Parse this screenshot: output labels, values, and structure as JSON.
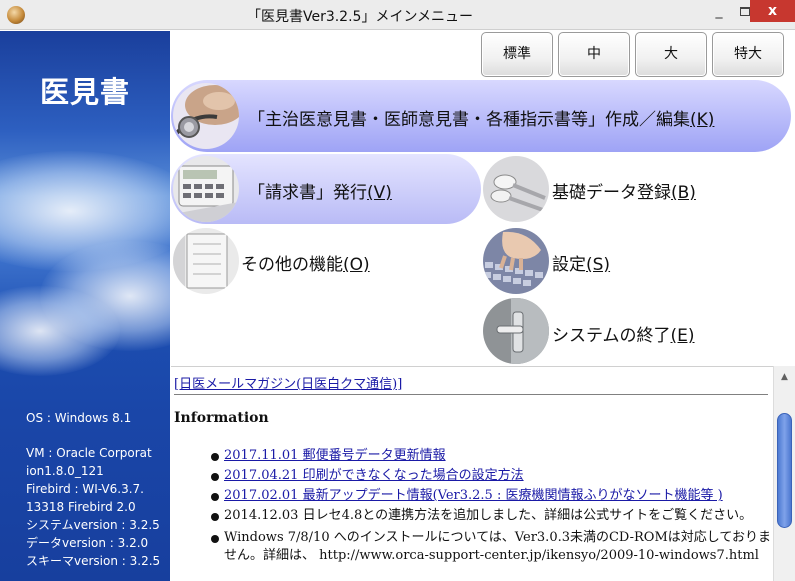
{
  "window": {
    "title": "「医見書Ver3.2.5」メインメニュー",
    "minimize_glyph": "_",
    "close_glyph": "x"
  },
  "sidebar": {
    "logo": "医見書",
    "info_lines": [
      "OS : Windows 8.1",
      "",
      "VM : Oracle Corporat",
      "ion1.8.0_121",
      "Firebird : WI-V6.3.7.",
      "13318 Firebird 2.0",
      "システムversion : 3.2.5",
      "データversion : 3.2.0",
      "スキーマversion : 3.2.5"
    ]
  },
  "size_buttons": [
    "標準",
    "中",
    "大",
    "特大"
  ],
  "menu": {
    "main": {
      "label": "「主治医意見書・医師意見書・各種指示書等」作成／編集",
      "key": "(K)"
    },
    "billing": {
      "label": "「請求書」発行",
      "key": "(V)"
    },
    "basic_data": {
      "label": "基礎データ登録",
      "key": "(B)"
    },
    "other": {
      "label": "その他の機能",
      "key": "(O)"
    },
    "settings": {
      "label": "設定",
      "key": "(S)"
    },
    "exit": {
      "label": "システムの終了",
      "key": "(E)"
    }
  },
  "info_panel": {
    "newsletter_link": "[日医メールマガジン(日医白クマ通信)]",
    "heading": "Information",
    "items": [
      {
        "type": "link",
        "text": "2017.11.01 郵便番号データ更新情報"
      },
      {
        "type": "link",
        "text": "2017.04.21 印刷ができなくなった場合の設定方法"
      },
      {
        "type": "link",
        "text": "2017.02.01 最新アップデート情報(Ver3.2.5 : 医療機関情報ふりがなソート機能等 )"
      },
      {
        "type": "text",
        "text": "2014.12.03 日レセ4.8との連携方法を追加しました、詳細は公式サイトをご覧ください。"
      },
      {
        "type": "text",
        "text": "Windows 7/8/10 へのインストールについては、Ver3.0.3未満のCD-ROMは対応しておりません。詳細は、 http://www.orca-support-center.jp/ikensyo/2009-10-windows7.html"
      }
    ]
  },
  "scrollbar": {
    "up_glyph": "▲"
  }
}
